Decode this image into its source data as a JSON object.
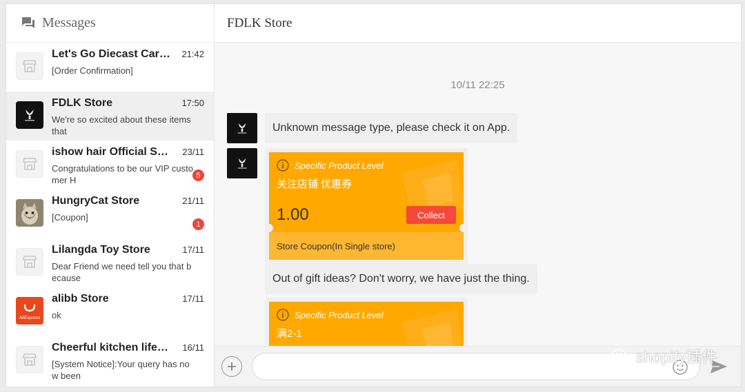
{
  "sidebar": {
    "title": "Messages",
    "icon": "chat-bubbles-icon",
    "conversations": [
      {
        "name": "Let's Go Diecast Car M...",
        "time": "21:42",
        "preview": "[Order Confirmation]",
        "avatar": "store-placeholder-icon",
        "badge": null,
        "active": false
      },
      {
        "name": "FDLK Store",
        "time": "17:50",
        "preview": "We're so excited about these items that",
        "avatar": "fdlk-logo",
        "badge": null,
        "active": true
      },
      {
        "name": "ishow hair Official Sto...",
        "time": "23/11",
        "preview": "Congratulations to be our VIP customer H",
        "avatar": "store-placeholder-icon",
        "badge": "5",
        "active": false
      },
      {
        "name": "HungryCat Store",
        "time": "21/11",
        "preview": "[Coupon]",
        "avatar": "cat-photo",
        "badge": "1",
        "active": false
      },
      {
        "name": "Lilangda Toy Store",
        "time": "17/11",
        "preview": "Dear Friend we need tell you that because",
        "avatar": "store-placeholder-icon",
        "badge": null,
        "active": false
      },
      {
        "name": "alibb Store",
        "time": "17/11",
        "preview": "ok",
        "avatar": "aliexpress-logo",
        "badge": null,
        "active": false
      },
      {
        "name": "Cheerful kitchen life S...",
        "time": "16/11",
        "preview": "[System Notice]:Your query has now been",
        "avatar": "store-placeholder-icon",
        "badge": null,
        "active": false
      }
    ],
    "aliexpress_logo_text": "AliExpress"
  },
  "chat": {
    "title": "FDLK Store",
    "timestamp": "10/11 22:25",
    "messages": {
      "unknown": "Unknown message type, please check it on App.",
      "gift": "Out of gift ideas? Don't worry, we have just the thing."
    },
    "coupon1": {
      "level": "Specific Product Level",
      "title": "关注店铺 优惠券",
      "value": "1.00",
      "button": "Collect",
      "footer": "Store Coupon(In Single store)"
    },
    "coupon2": {
      "level": "Specific Product Level",
      "title": "满2-1"
    }
  },
  "input": {
    "value": "",
    "placeholder": ""
  },
  "watermark": "shopify插件",
  "colors": {
    "coupon": "#ffa800",
    "coupon_footer": "#ffb731",
    "collect": "#f5483a",
    "badge": "#f0443b"
  }
}
